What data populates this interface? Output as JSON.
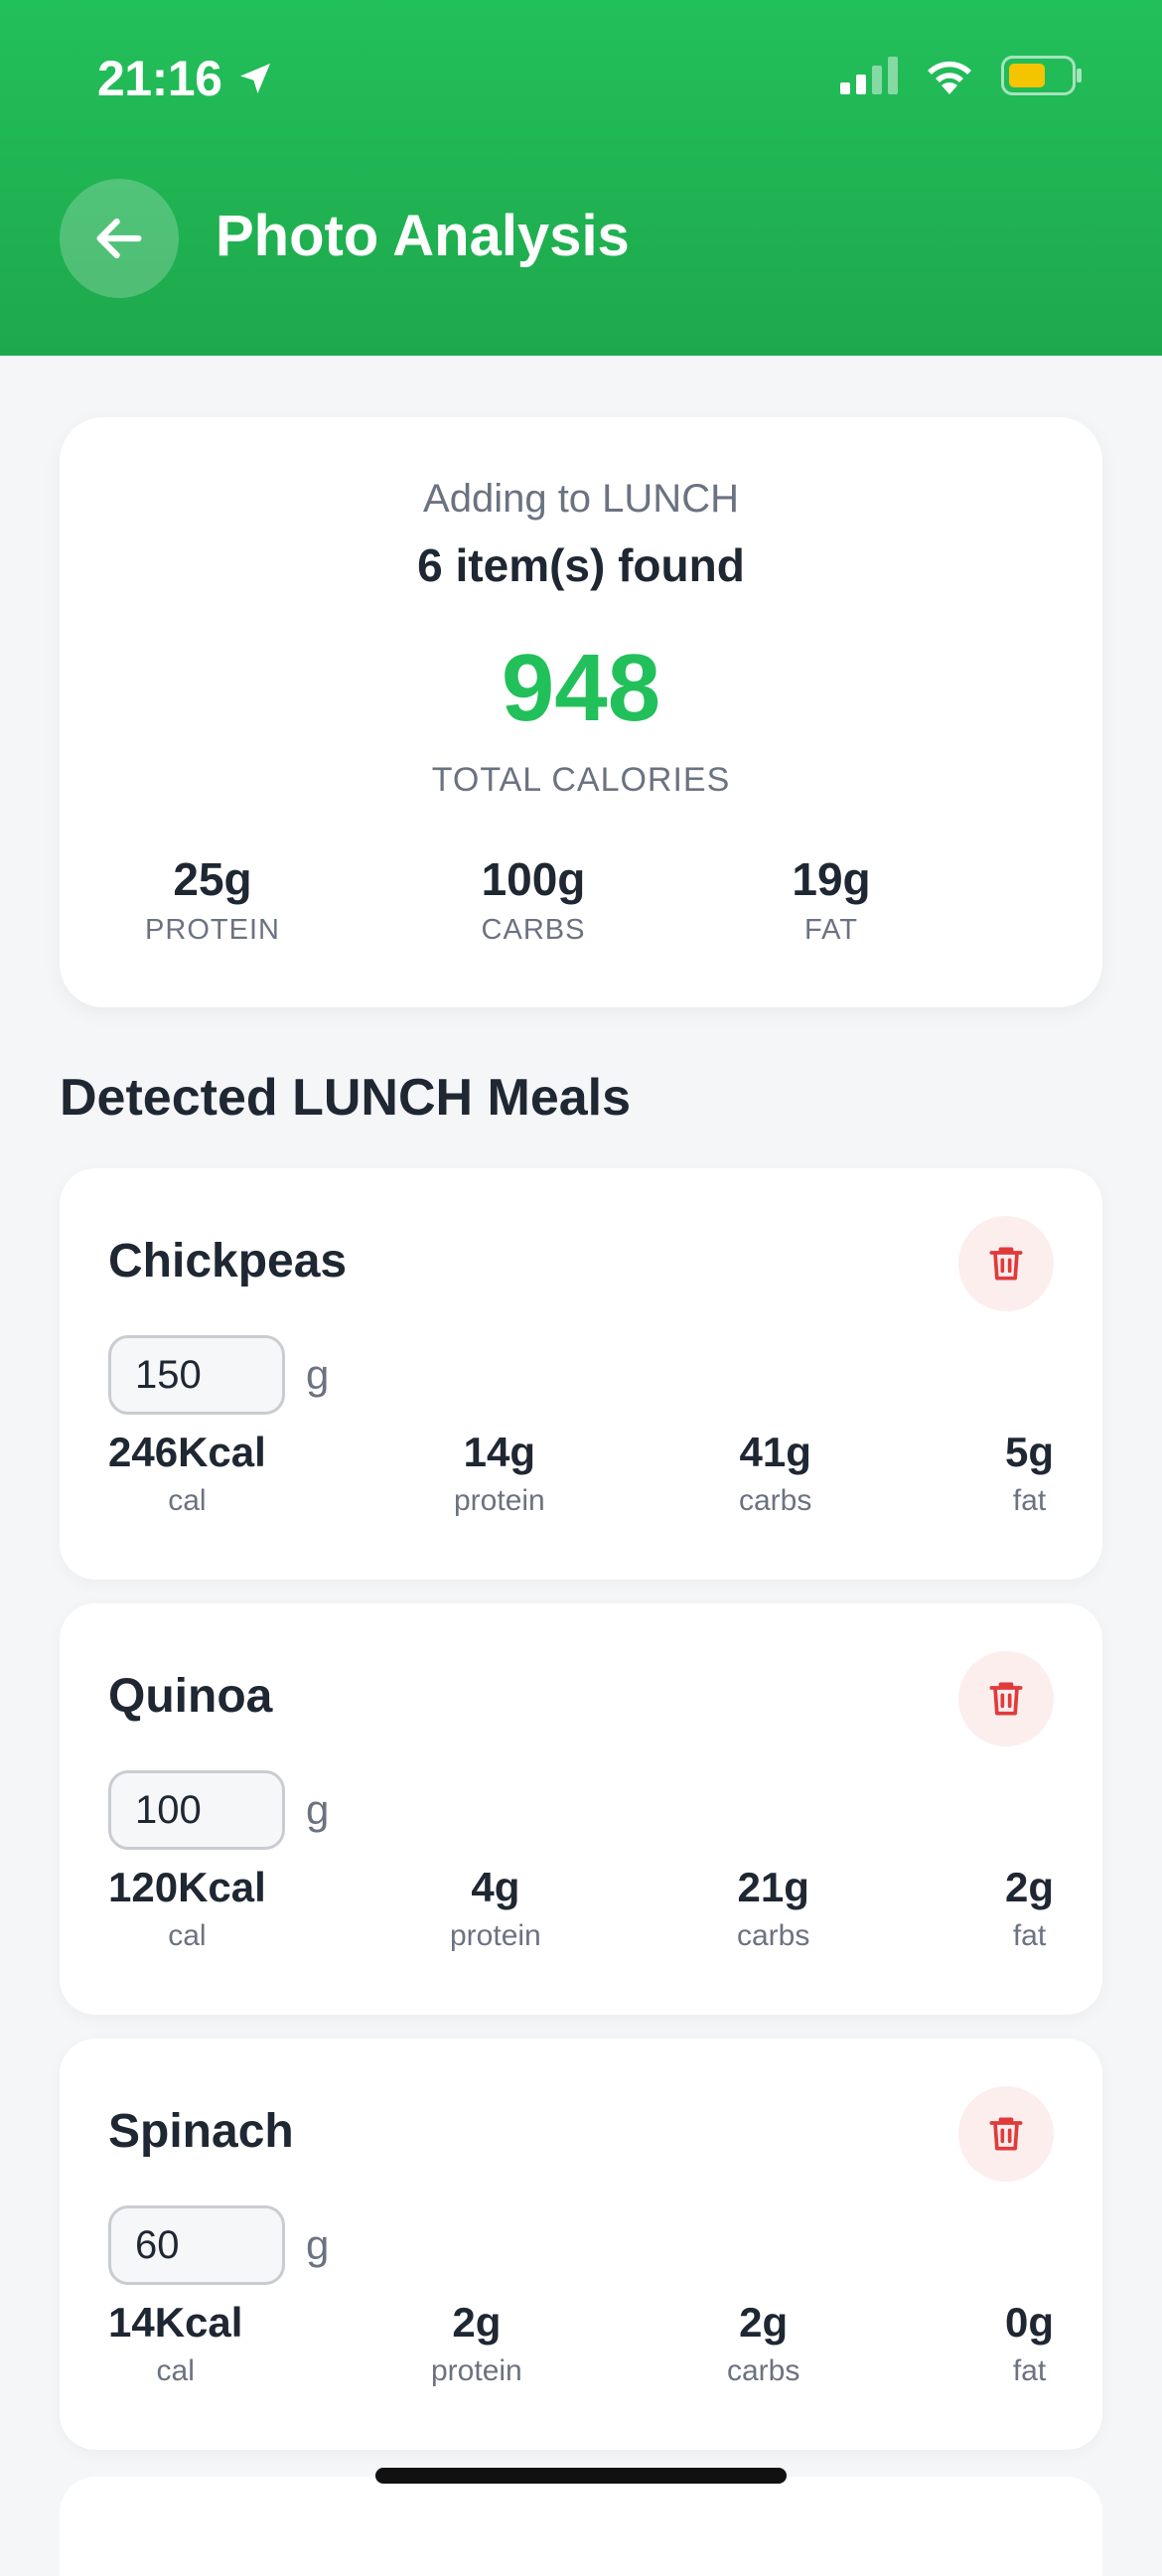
{
  "status_bar": {
    "time": "21:16",
    "battery_color": "#f5c400"
  },
  "header": {
    "title": "Photo Analysis",
    "back_icon": "arrow-left-icon",
    "bg_color": "#22c05a"
  },
  "summary": {
    "adding_to": "Adding to LUNCH",
    "items_found": "6 item(s) found",
    "total_calories": "948",
    "total_label": "TOTAL CALORIES",
    "macros": [
      {
        "value": "25g",
        "label": "PROTEIN"
      },
      {
        "value": "100g",
        "label": "CARBS"
      },
      {
        "value": "19g",
        "label": "FAT"
      }
    ]
  },
  "section": {
    "title": "Detected LUNCH Meals"
  },
  "meals": [
    {
      "name": "Chickpeas",
      "quantity": "150",
      "unit": "g",
      "cal": "246Kcal",
      "protein": "14g",
      "carbs": "41g",
      "fat": "5g"
    },
    {
      "name": "Quinoa",
      "quantity": "100",
      "unit": "g",
      "cal": "120Kcal",
      "protein": "4g",
      "carbs": "21g",
      "fat": "2g"
    },
    {
      "name": "Spinach",
      "quantity": "60",
      "unit": "g",
      "cal": "14Kcal",
      "protein": "2g",
      "carbs": "2g",
      "fat": "0g"
    }
  ],
  "stat_labels": {
    "cal": "cal",
    "protein": "protein",
    "carbs": "carbs",
    "fat": "fat"
  },
  "accent_color": "#22c05a",
  "delete_icon": "trash-icon"
}
